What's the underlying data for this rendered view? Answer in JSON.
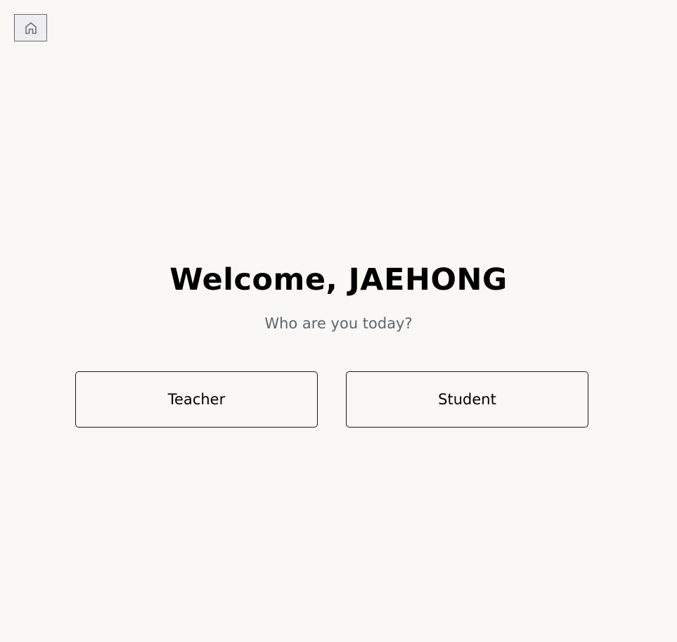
{
  "header": {
    "home_icon": "home-icon"
  },
  "main": {
    "title": "Welcome, JAEHONG",
    "subtitle": "Who are you today?",
    "roles": [
      {
        "label": "Teacher"
      },
      {
        "label": "Student"
      }
    ]
  },
  "colors": {
    "background": "#f9f8f5",
    "subtitle": "#5c6670",
    "border": "#1a1a1a",
    "home_button_bg": "#eeeef0"
  }
}
